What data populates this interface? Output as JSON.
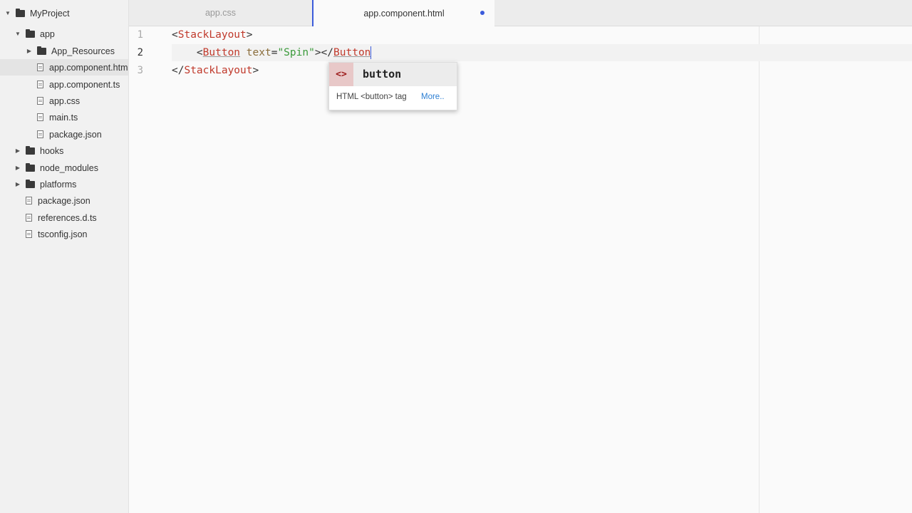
{
  "sidebar": {
    "project": "MyProject",
    "items": [
      {
        "label": "app"
      },
      {
        "label": "App_Resources"
      },
      {
        "label": "app.component.html"
      },
      {
        "label": "app.component.ts"
      },
      {
        "label": "app.css"
      },
      {
        "label": "main.ts"
      },
      {
        "label": "package.json"
      },
      {
        "label": "hooks"
      },
      {
        "label": "node_modules"
      },
      {
        "label": "platforms"
      },
      {
        "label": "package.json"
      },
      {
        "label": "references.d.ts"
      },
      {
        "label": "tsconfig.json"
      }
    ]
  },
  "tabs": [
    {
      "label": "app.css"
    },
    {
      "label": "app.component.html"
    }
  ],
  "editor": {
    "line_numbers": [
      "1",
      "2",
      "3"
    ],
    "line1": {
      "open": "<",
      "tag": "StackLayout",
      "close": ">"
    },
    "line2": {
      "indent": "    ",
      "open": "<",
      "tag": "Button",
      "space": " ",
      "attr": "text",
      "eq": "=",
      "value": "\"Spin\"",
      "mid": "></",
      "tag2": "Button"
    },
    "line3": {
      "open": "</",
      "tag": "StackLayout",
      "close": ">"
    }
  },
  "autocomplete": {
    "icon": "<>",
    "label": "button",
    "description": "HTML <button> tag",
    "more": "More.."
  },
  "colors": {
    "tag": "#c0392b",
    "attribute": "#8a6d3b",
    "string": "#3a9a3a",
    "accent": "#3b5bdb"
  }
}
